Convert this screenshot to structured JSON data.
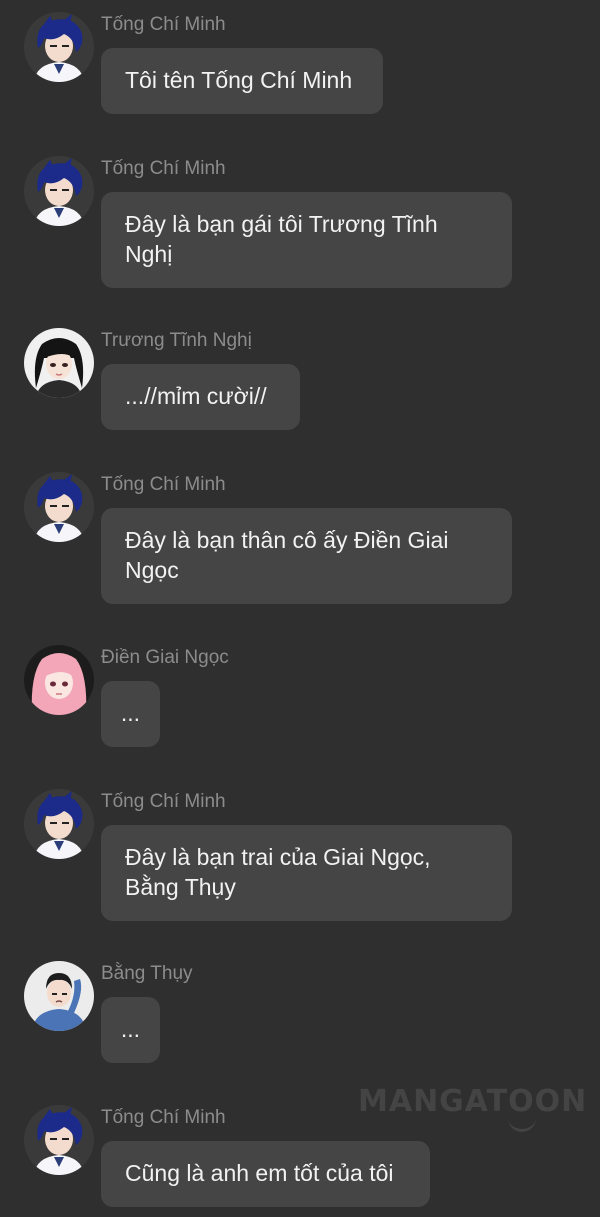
{
  "messages": [
    {
      "sender": "Tống Chí Minh",
      "text": "Tôi tên Tống Chí Minh",
      "avatar": "male-dark-blue-hair-avatar"
    },
    {
      "sender": "Tống Chí Minh",
      "text": "Đây là bạn gái tôi Trương Tĩnh Nghị",
      "avatar": "male-dark-blue-hair-avatar"
    },
    {
      "sender": "Trương Tĩnh Nghị",
      "text": "...//mỉm cười//",
      "avatar": "female-black-hair-avatar"
    },
    {
      "sender": "Tống Chí Minh",
      "text": "Đây là bạn thân cô ấy Điền Giai Ngọc",
      "avatar": "male-dark-blue-hair-avatar"
    },
    {
      "sender": "Điền Giai Ngọc",
      "text": "...",
      "avatar": "female-pink-hair-avatar"
    },
    {
      "sender": "Tống Chí Minh",
      "text": "Đây là bạn trai của Giai Ngọc, Bằng Thụy",
      "avatar": "male-dark-blue-hair-avatar"
    },
    {
      "sender": "Bằng Thụy",
      "text": "...",
      "avatar": "male-blue-shirt-avatar"
    },
    {
      "sender": "Tống Chí Minh",
      "text": "Cũng là anh em tốt của tôi",
      "avatar": "male-dark-blue-hair-avatar"
    }
  ],
  "watermark": "MANGATOON",
  "colors": {
    "background": "#2f2f2f",
    "bubble": "#454545",
    "sender_name": "#8c8c8c",
    "message_text": "#f2f2f2"
  }
}
